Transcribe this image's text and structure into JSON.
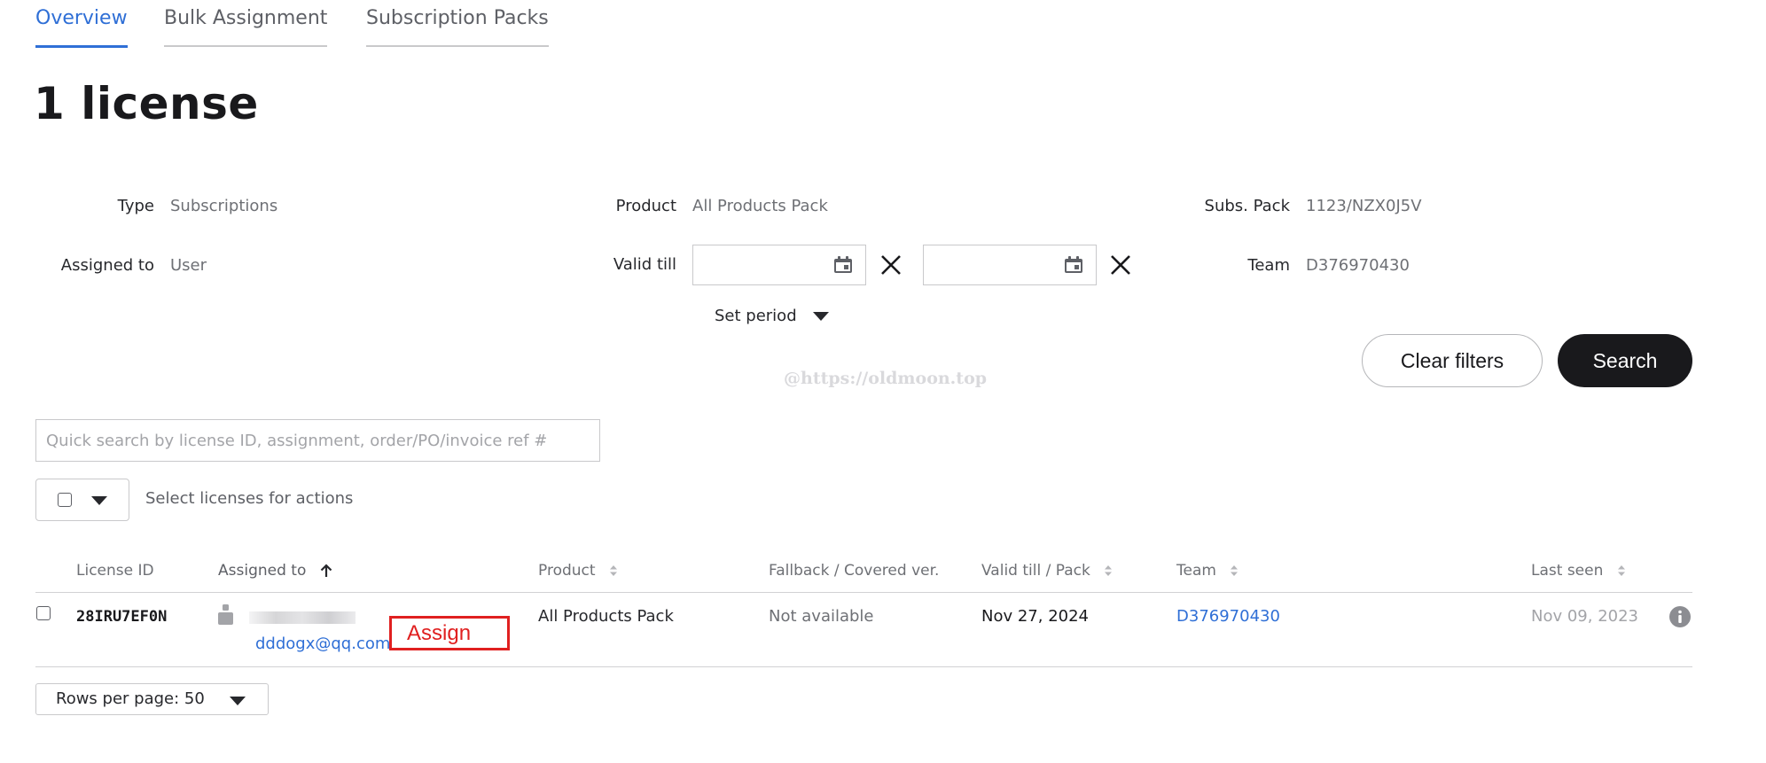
{
  "tabs": [
    {
      "label": "Overview",
      "active": true
    },
    {
      "label": "Bulk Assignment",
      "active": false
    },
    {
      "label": "Subscription Packs",
      "active": false
    }
  ],
  "page_title": "1 license",
  "filters": {
    "type": {
      "label": "Type",
      "value": "Subscriptions"
    },
    "assigned_to": {
      "label": "Assigned to",
      "value": "User"
    },
    "product": {
      "label": "Product",
      "value": "All Products Pack"
    },
    "valid_till": {
      "label": "Valid till",
      "from_value": "",
      "to_value": ""
    },
    "set_period": "Set period",
    "subs_pack": {
      "label": "Subs. Pack",
      "value": "1123/NZX0J5V"
    },
    "team": {
      "label": "Team",
      "value": "D376970430"
    }
  },
  "buttons": {
    "clear_filters": "Clear filters",
    "search": "Search"
  },
  "watermark": "@https://oldmoon.top",
  "quick_search": {
    "placeholder": "Quick search by license ID, assignment, order/PO/invoice ref #",
    "value": ""
  },
  "bulk_actions_label": "Select licenses for actions",
  "table": {
    "columns": [
      "License ID",
      "Assigned to",
      "Product",
      "Fallback / Covered ver.",
      "Valid till / Pack",
      "Team",
      "Last seen"
    ],
    "rows": [
      {
        "license_id": "28IRU7EF0N",
        "assigned_email": "dddogx@qq.com",
        "assign_label": "Assign",
        "product": "All Products Pack",
        "fallback": "Not available",
        "valid_till": "Nov 27, 2024",
        "team": "D376970430",
        "last_seen": "Nov 09, 2023"
      }
    ]
  },
  "pagination": {
    "rows_per_page": "Rows per page: 50"
  },
  "colors": {
    "accent": "#2f6fd6",
    "primary_button": "#19191c",
    "annotation_red": "#e02020"
  }
}
